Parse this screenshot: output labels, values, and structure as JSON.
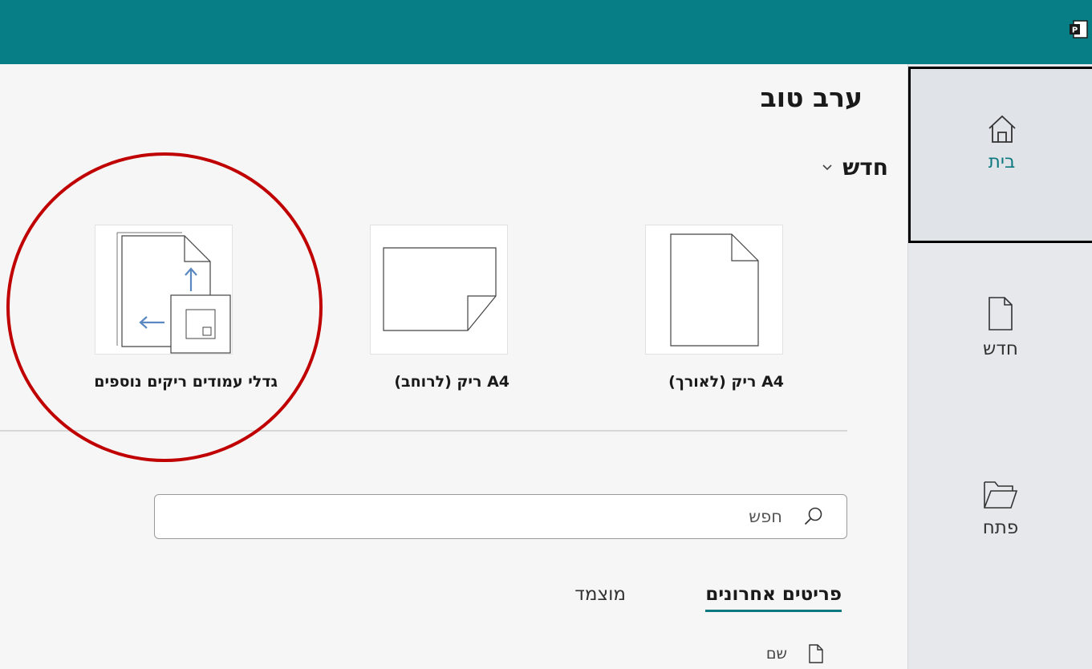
{
  "titlebar": {
    "app_icon": "publisher-icon"
  },
  "sidebar": {
    "items": [
      {
        "label": "בית",
        "icon": "home-icon",
        "active": true
      },
      {
        "label": "חדש",
        "icon": "new-document-icon",
        "active": false
      },
      {
        "label": "פתח",
        "icon": "folder-open-icon",
        "active": false
      }
    ]
  },
  "main": {
    "greeting": "ערב טוב",
    "new_section": {
      "label": "חדש",
      "templates": [
        {
          "label": "A4 ריק (לאורך)",
          "icon": "portrait-page-icon"
        },
        {
          "label": "A4 ריק (לרוחב)",
          "icon": "landscape-page-icon"
        },
        {
          "label": "גדלי עמודים ריקים נוספים",
          "icon": "more-page-sizes-icon"
        }
      ]
    },
    "search": {
      "placeholder": "חפש"
    },
    "tabs": [
      {
        "label": "פריטים אחרונים",
        "active": true
      },
      {
        "label": "מוצמד",
        "active": false
      }
    ],
    "list": {
      "column_name": "שם"
    }
  },
  "colors": {
    "titlebar": "#077e85",
    "accent": "#0e7a80",
    "annotation": "#c00000"
  }
}
